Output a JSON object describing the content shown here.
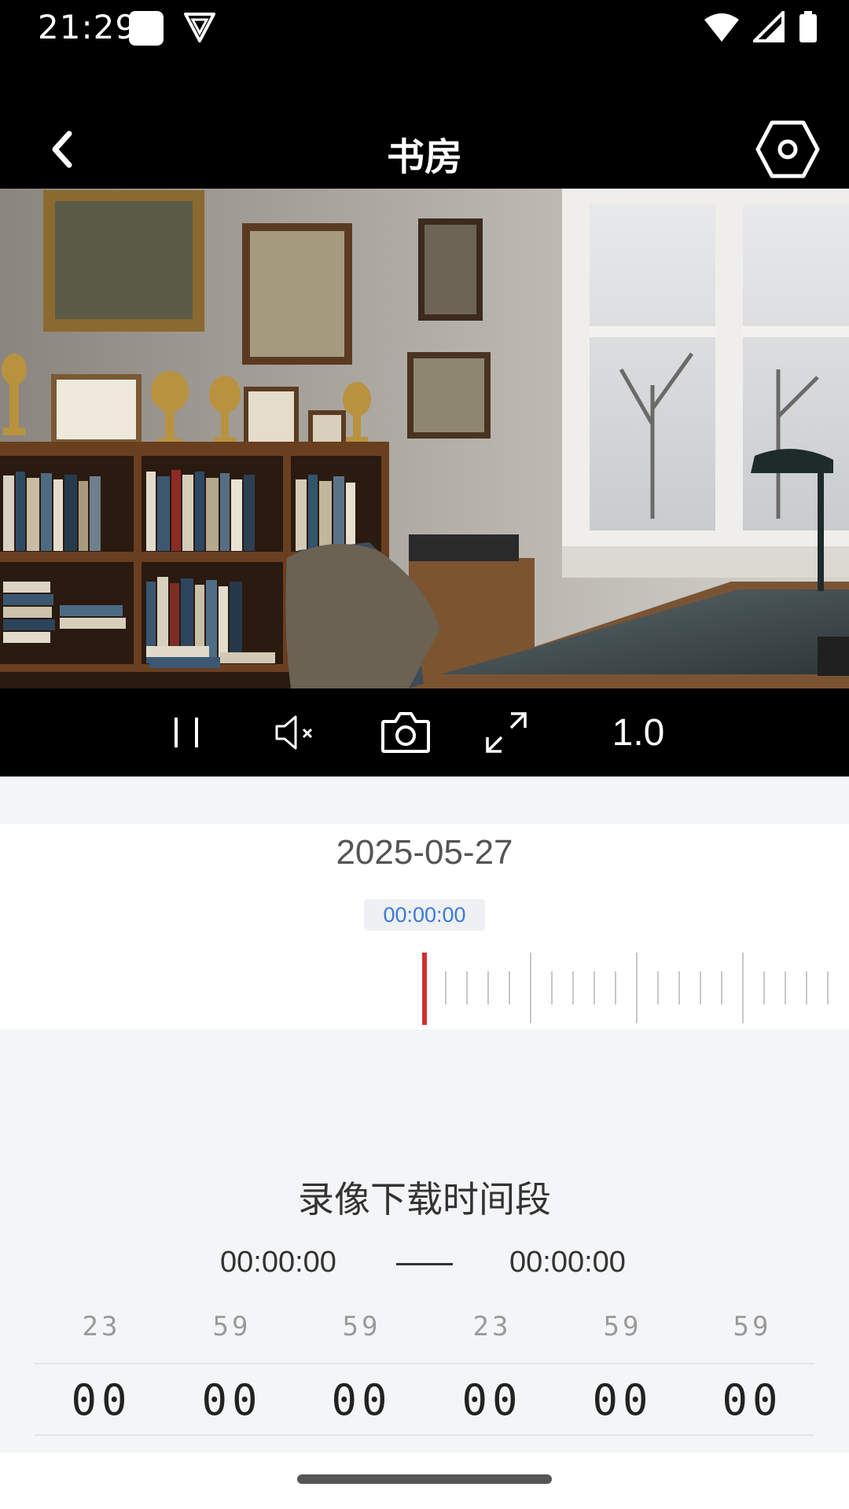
{
  "status_bar": {
    "time": "21:29"
  },
  "header": {
    "title": "书房"
  },
  "player": {
    "speed": "1.0"
  },
  "playback": {
    "date": "2025-05-27",
    "current_time": "00:00:00"
  },
  "download": {
    "title": "录像下载时间段",
    "start": "00:00:00",
    "end": "00:00:00",
    "picker_columns": [
      {
        "prev": "23",
        "value": "00"
      },
      {
        "prev": "59",
        "value": "00"
      },
      {
        "prev": "59",
        "value": "00"
      },
      {
        "prev": "23",
        "value": "00"
      },
      {
        "prev": "59",
        "value": "00"
      },
      {
        "prev": "59",
        "value": "00"
      }
    ]
  },
  "colors": {
    "accent_blue": "#3a7bd5",
    "timeline_marker": "#d32f2f"
  }
}
